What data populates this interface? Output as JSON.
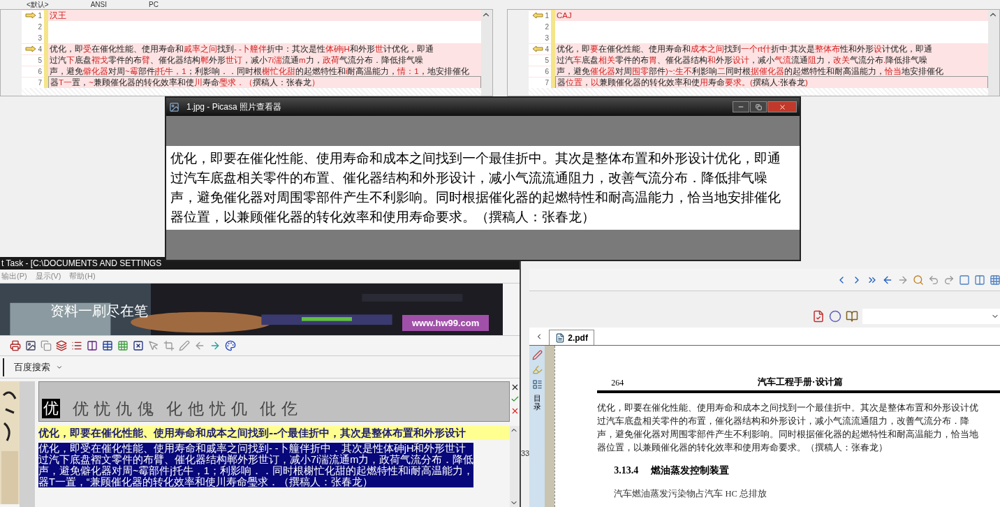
{
  "diff_header": [
    "<默认>",
    "ANSI",
    "PC"
  ],
  "diff_panes": [
    {
      "title": "汉王",
      "lines": [
        {
          "number": "1",
          "marker": true
        },
        {
          "number": "2",
          "marker": false
        },
        {
          "number": "3",
          "marker": false
        },
        {
          "number": "4",
          "marker": true,
          "segments": [
            {
              "t": "优化，即",
              "diff": false
            },
            {
              "t": "受",
              "diff": true
            },
            {
              "t": "在催化性能、使用寿命和",
              "diff": false
            },
            {
              "t": "戚率之问",
              "diff": true
            },
            {
              "t": "找到",
              "diff": false
            },
            {
              "t": "- -卜艟伴",
              "diff": true
            },
            {
              "t": "折中：其次是性",
              "diff": false
            },
            {
              "t": "体砷jH",
              "diff": true
            },
            {
              "t": "和外形",
              "diff": false
            },
            {
              "t": "世",
              "diff": true
            },
            {
              "t": "计优化，即通",
              "diff": false
            }
          ]
        },
        {
          "number": "5",
          "marker": false,
          "segments": [
            {
              "t": "过汽",
              "diff": false
            },
            {
              "t": "下",
              "diff": true
            },
            {
              "t": "底盘",
              "diff": false
            },
            {
              "t": "褶戈",
              "diff": true
            },
            {
              "t": "零件的布",
              "diff": false
            },
            {
              "t": "臂",
              "diff": true
            },
            {
              "t": "、催化器结构",
              "diff": false
            },
            {
              "t": "郸",
              "diff": true
            },
            {
              "t": "外形",
              "diff": false
            },
            {
              "t": "世订",
              "diff": true
            },
            {
              "t": "，减小",
              "diff": false
            },
            {
              "t": "7i湍",
              "diff": true
            },
            {
              "t": "流通",
              "diff": false
            },
            {
              "t": "m",
              "diff": true
            },
            {
              "t": "力，",
              "diff": false
            },
            {
              "t": "政荷",
              "diff": true
            },
            {
              "t": "气流分布．降低排气噪",
              "diff": false
            }
          ]
        },
        {
          "number": "6",
          "marker": false,
          "segments": [
            {
              "t": "声，避免",
              "diff": false
            },
            {
              "t": "僻化器",
              "diff": true
            },
            {
              "t": "对周",
              "diff": false
            },
            {
              "t": "~霉",
              "diff": true
            },
            {
              "t": "部件",
              "diff": false
            },
            {
              "t": "j托牛，1",
              "diff": true
            },
            {
              "t": "；利影响．．同时根",
              "diff": false
            },
            {
              "t": "榭忙化甜",
              "diff": true
            },
            {
              "t": "的起燃特性和",
              "diff": false
            },
            {
              "t": "i",
              "diff": true
            },
            {
              "t": "耐高温能力，",
              "diff": false
            },
            {
              "t": "情：1",
              "diff": true
            },
            {
              "t": "，地安排催化",
              "diff": false
            }
          ]
        },
        {
          "number": "7",
          "marker": false,
          "segments": [
            {
              "t": "器",
              "diff": false
            },
            {
              "t": "T一",
              "diff": true
            },
            {
              "t": "置，",
              "diff": false
            },
            {
              "t": "~",
              "diff": true
            },
            {
              "t": "兼顾催化器的转化效率和使",
              "diff": false
            },
            {
              "t": "川",
              "diff": true
            },
            {
              "t": "寿命",
              "diff": false
            },
            {
              "t": "璺求．（",
              "diff": true
            },
            {
              "t": "撰稿人：张春龙",
              "diff": false
            },
            {
              "t": "）",
              "diff": true
            }
          ]
        }
      ]
    },
    {
      "title": "CAJ",
      "lines": [
        {
          "number": "1",
          "marker": true
        },
        {
          "number": "2",
          "marker": false
        },
        {
          "number": "3",
          "marker": false
        },
        {
          "number": "4",
          "marker": true,
          "segments": [
            {
              "t": "优化，即",
              "diff": false
            },
            {
              "t": "要",
              "diff": true
            },
            {
              "t": "在催化性能、使用寿命和",
              "diff": false
            },
            {
              "t": "成本之间",
              "diff": true
            },
            {
              "t": "找到",
              "diff": false
            },
            {
              "t": "一个rt什",
              "diff": true
            },
            {
              "t": "折中",
              "diff": false
            },
            {
              "t": ":",
              "diff": true
            },
            {
              "t": "其次是",
              "diff": false
            },
            {
              "t": "整体布",
              "diff": true
            },
            {
              "t": "性和外形",
              "diff": false
            },
            {
              "t": "设",
              "diff": true
            },
            {
              "t": "计优化，即通",
              "diff": false
            }
          ]
        },
        {
          "number": "5",
          "marker": false,
          "segments": [
            {
              "t": "过汽",
              "diff": false
            },
            {
              "t": "车",
              "diff": true
            },
            {
              "t": "底盘",
              "diff": false
            },
            {
              "t": "相关",
              "diff": true
            },
            {
              "t": "零件的布",
              "diff": false
            },
            {
              "t": "胃",
              "diff": true
            },
            {
              "t": "、催化器结构",
              "diff": false
            },
            {
              "t": "和",
              "diff": true
            },
            {
              "t": "外形",
              "diff": false
            },
            {
              "t": "设计",
              "diff": true
            },
            {
              "t": "，减小",
              "diff": false
            },
            {
              "t": "气流",
              "diff": true
            },
            {
              "t": "流通",
              "diff": false
            },
            {
              "t": "阻",
              "diff": true
            },
            {
              "t": "力，",
              "diff": false
            },
            {
              "t": "改关",
              "diff": true
            },
            {
              "t": "气流分布",
              "diff": false
            },
            {
              "t": ".",
              "diff": true
            },
            {
              "t": "降低排气噪",
              "diff": false
            }
          ]
        },
        {
          "number": "6",
          "marker": false,
          "segments": [
            {
              "t": "声，避免",
              "diff": false
            },
            {
              "t": "催化器",
              "diff": true
            },
            {
              "t": "对周",
              "diff": false
            },
            {
              "t": "围零",
              "diff": true
            },
            {
              "t": "部件",
              "diff": false
            },
            {
              "t": ")~:生不",
              "diff": true
            },
            {
              "t": "利影响",
              "diff": false
            },
            {
              "t": "二",
              "diff": true
            },
            {
              "t": "同时根",
              "diff": false
            },
            {
              "t": "据催化器",
              "diff": true
            },
            {
              "t": "的起燃特性和耐高温能力，",
              "diff": false
            },
            {
              "t": "恰当",
              "diff": true
            },
            {
              "t": "地安排催化",
              "diff": false
            }
          ]
        },
        {
          "number": "7",
          "marker": false,
          "segments": [
            {
              "t": "器",
              "diff": false
            },
            {
              "t": "位置",
              "diff": true
            },
            {
              "t": "，",
              "diff": false
            },
            {
              "t": "以",
              "diff": true
            },
            {
              "t": "兼顾催化器的转化效率和使",
              "diff": false
            },
            {
              "t": "用",
              "diff": true
            },
            {
              "t": "寿命",
              "diff": false
            },
            {
              "t": "要求。(",
              "diff": true
            },
            {
              "t": "撰稿人",
              "diff": false
            },
            {
              "t": ":",
              "diff": true
            },
            {
              "t": "张春龙",
              "diff": false
            },
            {
              "t": ")",
              "diff": true
            }
          ]
        }
      ]
    }
  ],
  "picasa": {
    "title": "1.jpg - Picasa 照片查看器",
    "image_lines": [
      "优化，即要在催化性能、使用寿命和成本之间找到一个最佳折中。其次是整体布置和外形设计优化，即通",
      "过汽车底盘相关零件的布置、催化器结构和外形设计，减小气流流通阻力，改善气流分布．降低排气噪",
      "声，避免催化器对周围零部件产生不利影响。同时根据催化器的起燃特性和耐高温能力，恰当地安排催化",
      "器位置，以兼顾催化器的转化效率和使用寿命要求。（撰稿人：张春龙）"
    ]
  },
  "ocr_window": {
    "title": "t Task - [C:\\DOCUMENTS AND SETTINGS",
    "menu": [
      "输出(P)",
      "显示(V)",
      "帮助(H)"
    ],
    "banner": {
      "slogan": "资料一刷尽在笔",
      "url": "www.hw99.com"
    },
    "search_engine": "百度搜索",
    "candidates": {
      "current": "优",
      "groups": [
        [
          "优",
          "忧",
          "仇",
          "傀"
        ],
        [
          "化",
          "他",
          "忧",
          "仉"
        ],
        [
          "仳",
          "仡"
        ]
      ]
    },
    "reference_line": "优化，即要在催化性能、使用寿命和成本之间找到--个最佳折中，其次是整体布置和外形设计",
    "recognized_lines": [
      "优化，即受在催化性能、使用寿命和戚率之问找到- -卜艟伴折中．其次是性体砷jH和外形世计",
      "过汽下底盘褶文零件的布臂、催化器结构郸外形世订，减小7i湍流通m力，政荷气流分布．降低",
      "声，避免僻化器对周~霉部件j托牛，1；利影响．．同时根榭忙化甜的起燃特性和i耐高温能力，",
      "器T一置，“兼顾催化器的转化效率和使川寿命璺求．（撰稿人：张春龙）"
    ]
  },
  "pdf_window": {
    "side_number": "33",
    "tabs": [
      {
        "label": "2.pdf",
        "selected": true
      }
    ],
    "side_panel_label": "目录",
    "page": {
      "number": "264",
      "running_title": "汽车工程手册·设计篇",
      "paragraph": [
        "优化，即要在催化性能、使用寿命和成本之间找到一个最佳折中。其次是整体布置和外形设计优",
        "过汽车底盘相关零件的布置，催化器结构和外形设计，减小气流流通阻力，改善气流分布．降",
        "声，避免催化器对周围零部件产生不利影响。同时根据催化器的起燃特性和耐高温能力，恰当地",
        "器位置，以兼顾催化器的转化效率和使用寿命要求。（撰稿人：张春龙）"
      ],
      "section_number": "3.13.4",
      "section_title": "燃油蒸发控制装置",
      "body_start": "汽车燃油蒸发污染物占汽车 HC 总排放"
    }
  }
}
